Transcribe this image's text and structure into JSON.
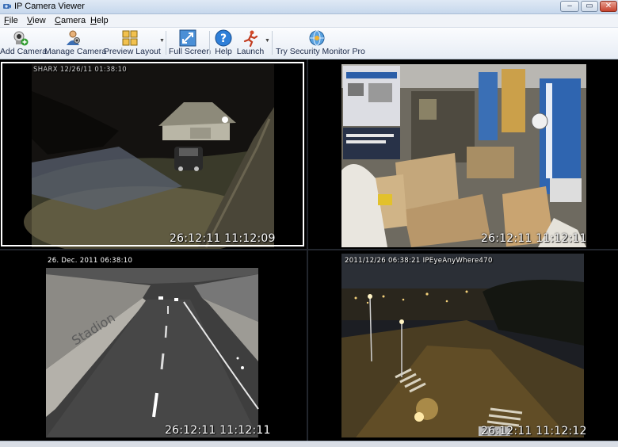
{
  "window": {
    "title": "IP Camera Viewer",
    "controls": {
      "minimize": "–",
      "maximize": "▭",
      "close": "✕"
    }
  },
  "menu": [
    {
      "label": "File",
      "underline": "F",
      "rest": "ile"
    },
    {
      "label": "View",
      "underline": "V",
      "rest": "iew"
    },
    {
      "label": "Camera",
      "underline": "C",
      "rest": "amera"
    },
    {
      "label": "Help",
      "underline": "H",
      "rest": "elp"
    }
  ],
  "toolbar": {
    "add_camera": "Add Camera",
    "manage_camera": "Manage Camera",
    "preview_layout": "Preview Layout",
    "full_screen": "Full Screen",
    "help": "Help",
    "launch": "Launch",
    "try_pro": "Try Security Monitor Pro"
  },
  "cameras": [
    {
      "id": "cam1",
      "scene": "night driveway outside house",
      "osd_top": "SHARX 12/26/11 01:38:10",
      "timestamp": "26:12:11 11:12:09",
      "selected": true
    },
    {
      "id": "cam2",
      "scene": "office storeroom with boxes and VIVOTEK banners",
      "osd_top": "",
      "timestamp": "26:12:11 11:12:11",
      "selected": false
    },
    {
      "id": "cam3",
      "scene": "road tunnel",
      "osd_top": "26. Dec. 2011 06:38:10",
      "timestamp": "26:12:11 11:12:11",
      "selected": false
    },
    {
      "id": "cam4",
      "scene": "city intersection at night",
      "osd_top": "2011/12/26 06:38:21    IPEyeAnyWhere470",
      "timestamp": "26:12:11 11:12:12",
      "selected": false
    }
  ],
  "colors": {
    "titlebar": "#c6d7ec",
    "toolbar": "#e7edf5",
    "selected_border": "#ffffff"
  }
}
